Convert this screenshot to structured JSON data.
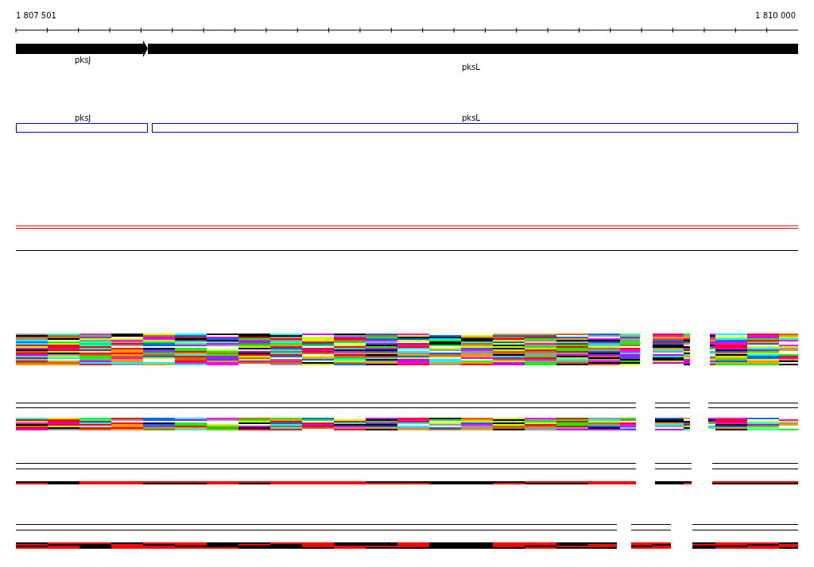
{
  "ruler": {
    "start_label": "1 807 501",
    "end_label": "1 810 000"
  },
  "gene_track": {
    "genes": [
      {
        "name": "pksJ"
      },
      {
        "name": "pksL"
      }
    ]
  },
  "cds_track": {
    "features": [
      {
        "name": "pksJ"
      },
      {
        "name": "pksL"
      }
    ]
  }
}
